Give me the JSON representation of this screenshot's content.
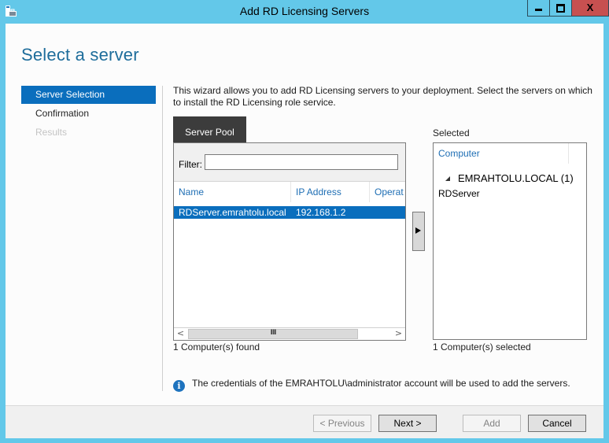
{
  "window": {
    "title": "Add RD Licensing Servers",
    "icon": "server-manager-icon",
    "controls": {
      "minimize": "minimize",
      "maximize": "maximize",
      "close": "X"
    }
  },
  "page": {
    "title": "Select a server"
  },
  "nav": {
    "items": [
      {
        "label": "Server Selection",
        "state": "active"
      },
      {
        "label": "Confirmation",
        "state": "normal"
      },
      {
        "label": "Results",
        "state": "disabled"
      }
    ]
  },
  "intro": "This wizard allows you to add RD Licensing servers to your deployment. Select the servers on which to install the RD Licensing role service.",
  "server_pool": {
    "tab_label": "Server Pool",
    "filter_label": "Filter:",
    "filter_value": "",
    "columns": [
      "Name",
      "IP Address",
      "Operat"
    ],
    "rows": [
      {
        "name": "RDServer.emrahtolu.local",
        "ip": "192.168.1.2",
        "os": ""
      }
    ],
    "status": "1 Computer(s) found",
    "scroll_grip": "III"
  },
  "add_arrow_icon": "right-arrow",
  "selected": {
    "label": "Selected",
    "column": "Computer",
    "group": "EMRAHTOLU.LOCAL (1)",
    "items": [
      "RDServer"
    ],
    "status": "1 Computer(s) selected"
  },
  "info_message": "The credentials of the EMRAHTOLU\\administrator account will be used to add the servers.",
  "buttons": {
    "previous": "< Previous",
    "next": "Next >",
    "add": "Add",
    "cancel": "Cancel"
  },
  "colors": {
    "window_chrome": "#63c8e9",
    "accent": "#0a6ebd",
    "close_button": "#c75050",
    "header_link": "#1e6eb4"
  }
}
